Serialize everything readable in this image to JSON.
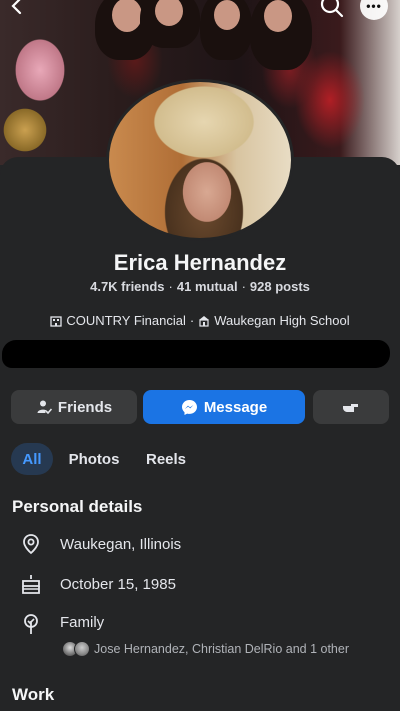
{
  "profile": {
    "name": "Erica Hernandez",
    "friends": "4.7K friends",
    "mutual": "41 mutual",
    "posts": "928 posts",
    "work": "COUNTRY Financial",
    "school": "Waukegan High School"
  },
  "actions": {
    "friends_label": "Friends",
    "message_label": "Message"
  },
  "tabs": [
    {
      "label": "All",
      "selected": true
    },
    {
      "label": "Photos"
    },
    {
      "label": "Reels"
    }
  ],
  "personal_details": {
    "title": "Personal details",
    "location": "Waukegan, Illinois",
    "birthday": "October 15, 1985",
    "family_label": "Family",
    "family_members": "Jose Hernandez, Christian DelRio and 1 other"
  },
  "work_section": {
    "title": "Work"
  },
  "icons": {
    "back": "back-arrow-icon",
    "search": "search-icon",
    "more": "more-icon",
    "add_friend": "friends-icon",
    "messenger": "messenger-icon",
    "poke": "poke-icon",
    "location": "location-pin-icon",
    "birthday": "birthday-cake-icon",
    "family": "family-icon"
  },
  "colors": {
    "background": "#242526",
    "accent_blue": "#1b74e4",
    "tab_selected_bg": "#263951",
    "tab_selected_text": "#4599ff"
  }
}
